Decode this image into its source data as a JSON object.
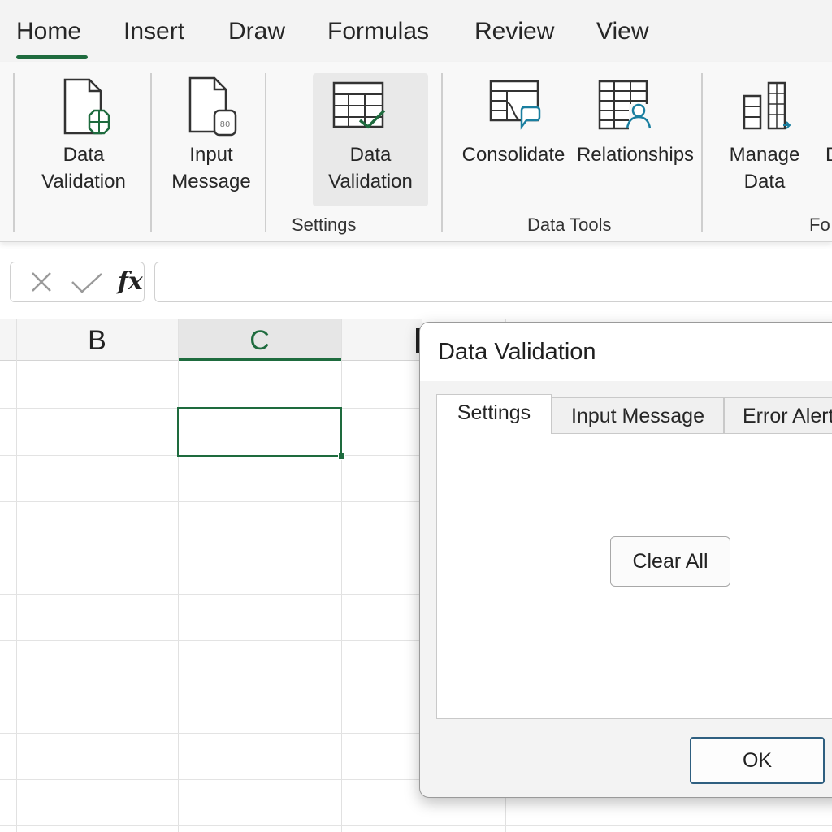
{
  "menu": {
    "tabs": [
      {
        "label": "Home"
      },
      {
        "label": "Insert"
      },
      {
        "label": "Draw"
      },
      {
        "label": "Formulas"
      },
      {
        "label": "Review"
      },
      {
        "label": "View"
      }
    ],
    "active": "Home"
  },
  "ribbon": {
    "buttons": [
      {
        "label": "Data\nValidation",
        "icon": "document-validation-icon"
      },
      {
        "label": "Input\nMessage",
        "icon": "document-input-message-icon"
      },
      {
        "label": "Data\nValidation",
        "icon": "table-checkmark-icon",
        "active": true
      },
      {
        "label": "Consolidate",
        "icon": "consolidate-icon"
      },
      {
        "label": "Relationships",
        "icon": "relationships-icon"
      },
      {
        "label": "Manage\nData",
        "icon": "manage-data-icon"
      },
      {
        "label": "D",
        "icon": ""
      }
    ],
    "groups": [
      {
        "label": "Settings"
      },
      {
        "label": "Data Tools"
      },
      {
        "label": "Fo"
      }
    ]
  },
  "formula_bar": {
    "cancel_icon": "close-icon",
    "enter_icon": "checkmark-icon",
    "fx_label": "fx",
    "value": ""
  },
  "grid": {
    "columns": [
      {
        "label": "B"
      },
      {
        "label": "C",
        "selected": true
      }
    ],
    "active_cell": "C2"
  },
  "dialog": {
    "title": "Data Validation",
    "tabs": [
      {
        "label": "Settings",
        "active": true
      },
      {
        "label": "Input Message"
      },
      {
        "label": "Error Alert"
      }
    ],
    "clear_all_label": "Clear All",
    "ok_label": "OK"
  },
  "colors": {
    "accent": "#1e6b3e",
    "ok_border": "#2f5f80",
    "icon_teal": "#1a7fa0"
  }
}
